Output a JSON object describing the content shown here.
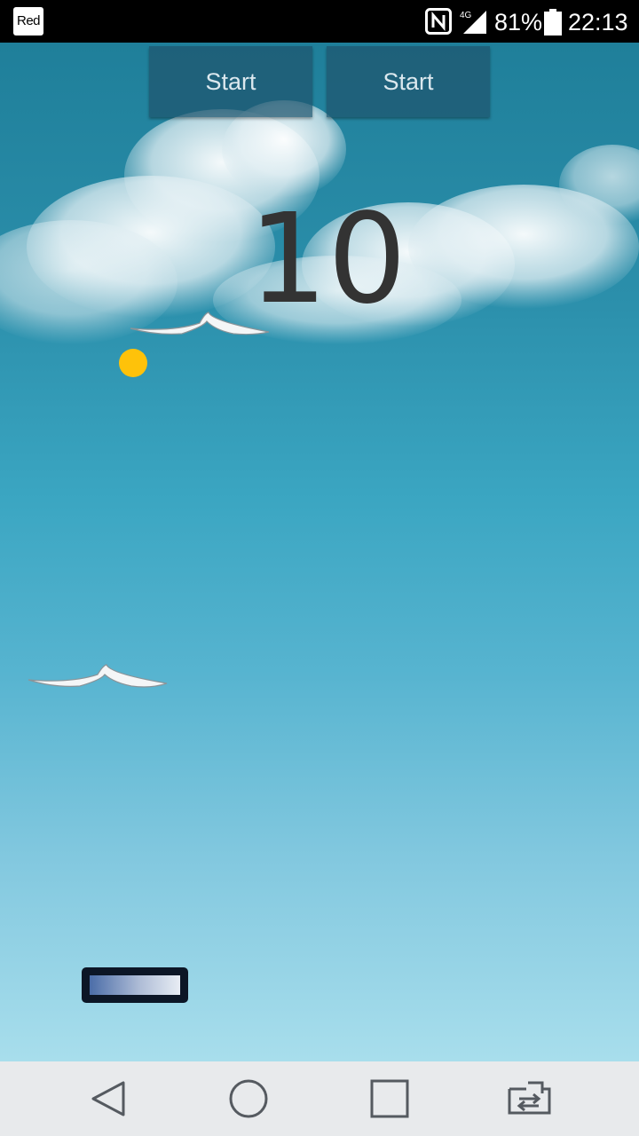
{
  "status_bar": {
    "carrier": "Red",
    "battery_percent": "81%",
    "time": "22:13",
    "network_label": "4G",
    "icons": [
      "nfc-icon",
      "signal-icon",
      "battery-icon"
    ]
  },
  "game": {
    "buttons": [
      {
        "label": "Start"
      },
      {
        "label": "Start"
      }
    ],
    "score": "10",
    "colors": {
      "ball": "#fec20a",
      "sky_top": "#1f7f9a",
      "sky_bottom": "#a8deec",
      "score": "#333333"
    }
  },
  "nav_bar": {
    "icons": [
      "back-icon",
      "home-icon",
      "recent-apps-icon",
      "switch-app-icon"
    ]
  }
}
